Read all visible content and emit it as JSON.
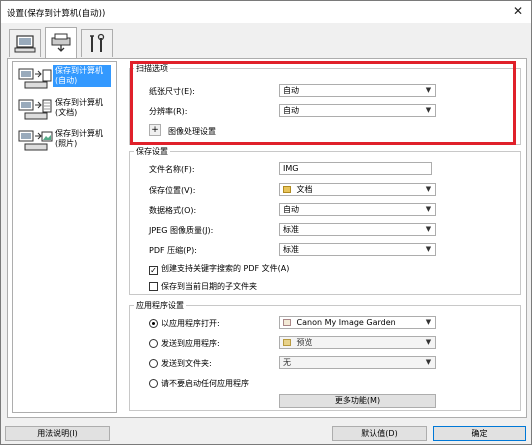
{
  "window": {
    "title": "设置(保存到计算机(自动))",
    "close_glyph": "✕"
  },
  "tabs": [
    {
      "name": "scan-from-computer"
    },
    {
      "name": "scan-from-panel"
    },
    {
      "name": "general-settings"
    }
  ],
  "sidebar": {
    "items": [
      {
        "label": "保存到计算机\n(自动)"
      },
      {
        "label": "保存到计算机\n(文档)"
      },
      {
        "label": "保存到计算机\n(照片)"
      }
    ]
  },
  "scan_options": {
    "title": "扫描选项",
    "paper_size_label": "纸张尺寸(E):",
    "paper_size_value": "自动",
    "resolution_label": "分辨率(R):",
    "resolution_value": "自动",
    "image_processing_label": "图像处理设置",
    "plus": "+"
  },
  "save_settings": {
    "title": "保存设置",
    "filename_label": "文件名称(F):",
    "filename_value": "IMG",
    "save_in_label": "保存位置(V):",
    "save_in_value": "文档",
    "data_format_label": "数据格式(O):",
    "data_format_value": "自动",
    "jpeg_quality_label": "JPEG 图像质量(J):",
    "jpeg_quality_value": "标准",
    "pdf_compression_label": "PDF 压缩(P):",
    "pdf_compression_value": "标准",
    "create_searchable_pdf_label": "创建支持关键字搜索的 PDF 文件(A)",
    "create_searchable_pdf_checked": true,
    "save_to_date_subfolder_label": "保存到当前日期的子文件夹",
    "save_to_date_subfolder_checked": false
  },
  "app_settings": {
    "title": "应用程序设置",
    "open_with_label": "以应用程序打开:",
    "open_with_value": "Canon My Image Garden",
    "send_to_app_label": "发送到应用程序:",
    "send_to_app_value": "预览",
    "send_to_folder_label": "发送到文件夹:",
    "send_to_folder_value": "无",
    "do_not_start_label": "请不要启动任何应用程序",
    "more_functions_label": "更多功能(M)",
    "selected": "open_with"
  },
  "footer": {
    "help_label": "用法说明(I)",
    "defaults_label": "默认值(D)",
    "ok_label": "确定"
  },
  "colors": {
    "highlight": "#e0202a",
    "selection": "#3399ff"
  }
}
